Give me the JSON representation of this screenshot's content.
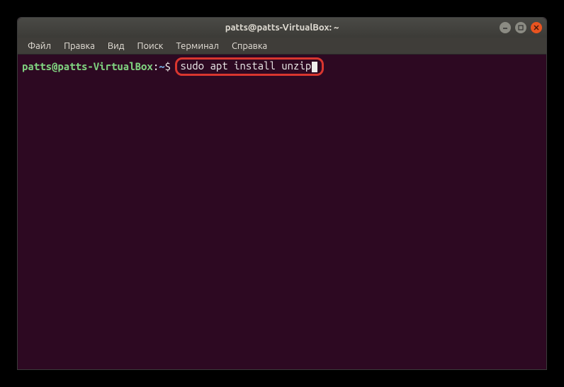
{
  "window": {
    "title": "patts@patts-VirtualBox: ~"
  },
  "menubar": {
    "items": [
      {
        "label": "Файл"
      },
      {
        "label": "Правка"
      },
      {
        "label": "Вид"
      },
      {
        "label": "Поиск"
      },
      {
        "label": "Терминал"
      },
      {
        "label": "Справка"
      }
    ]
  },
  "terminal": {
    "prompt": {
      "userhost": "patts@patts-VirtualBox",
      "colon": ":",
      "path": "~",
      "dollar": "$"
    },
    "command": "sudo apt install unzip"
  }
}
